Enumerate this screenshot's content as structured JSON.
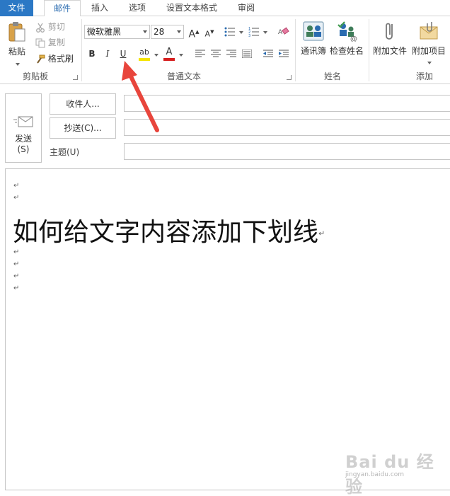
{
  "tabs": [
    {
      "label": "文件"
    },
    {
      "label": "邮件"
    },
    {
      "label": "插入"
    },
    {
      "label": "选项"
    },
    {
      "label": "设置文本格式"
    },
    {
      "label": "审阅"
    }
  ],
  "ribbon": {
    "clipboard": {
      "group_label": "剪贴板",
      "paste_label": "粘贴",
      "cut_label": "剪切",
      "copy_label": "复制",
      "format_painter_label": "格式刷"
    },
    "basic_text": {
      "group_label": "普通文本",
      "font_name": "微软雅黑",
      "font_size": "28",
      "bold_label": "B",
      "italic_label": "I",
      "underline_label": "U",
      "grow_font_label": "A",
      "shrink_font_label": "A",
      "highlight_label": "ab",
      "font_color_label": "A",
      "highlight_color": "#f5e400",
      "font_color": "#d61f1f"
    },
    "names": {
      "group_label": "姓名",
      "address_book_label": "通讯簿",
      "check_names_label": "检查姓名"
    },
    "include": {
      "group_label": "添加",
      "attach_file_label": "附加文件",
      "attach_item_label": "附加项目"
    }
  },
  "compose": {
    "send_label_line1": "发送",
    "send_label_line2": "(S)",
    "to_button_label": "收件人...",
    "cc_button_label": "抄送(C)...",
    "subject_label": "主题(U)",
    "to_value": "",
    "cc_value": "",
    "subject_value": ""
  },
  "body": {
    "paragraph_mark": "↵",
    "headline": "如何给文字内容添加下划线"
  },
  "watermark": {
    "logo_text": "Bai du 经验",
    "url": "jingyan.baidu.com"
  },
  "colors": {
    "accent": "#2b78c5",
    "annotation_arrow": "#e8453c"
  }
}
